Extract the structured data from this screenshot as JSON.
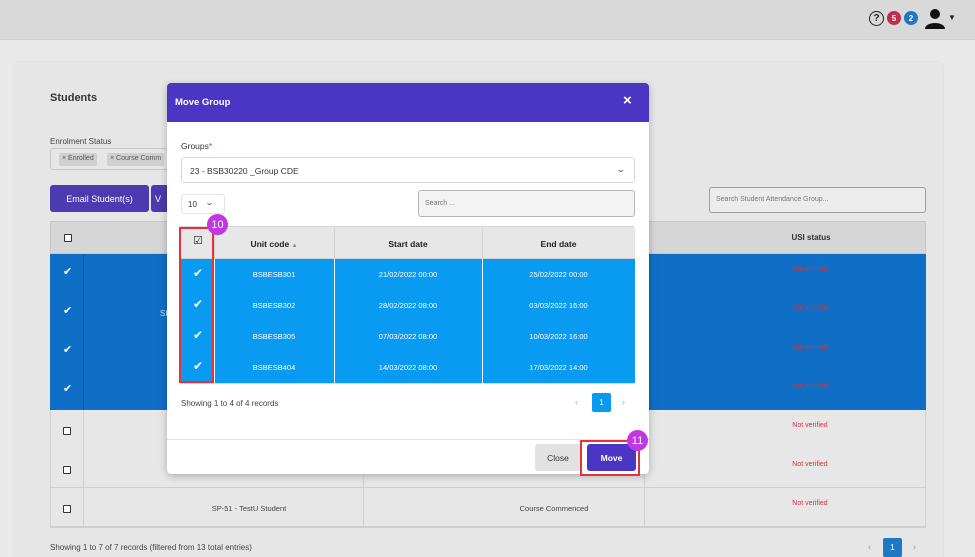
{
  "header": {
    "help_icon": "?",
    "badges": [
      {
        "value": "5",
        "color": "#c22d4b"
      },
      {
        "value": "2",
        "color": "#1d78c6"
      }
    ],
    "user_icon": "user-icon"
  },
  "background": {
    "title": "Students",
    "filter_label": "Enrolment Status",
    "filter_chips": [
      "× Enrolled",
      "× Course Comm"
    ],
    "email_button": "Email Student(s)",
    "partial_button": "V",
    "attendance_search_placeholder": "Search Student Attendance Group...",
    "usi_header": "USI status",
    "usi_values": [
      "Not verified",
      "Not verified",
      "Not verified",
      "Not verified",
      "Not verified",
      "Not verified",
      "Not verified"
    ],
    "partial_text": "SI",
    "last_row": {
      "student": "SP-51 - TestU Student",
      "status": "Course Commenced"
    },
    "showing": "Showing 1 to 7 of 7 records (filtered from 13 total entries)",
    "page": "1"
  },
  "modal": {
    "title": "Move Group",
    "close_symbol": "×",
    "groups_label": "Groups",
    "required_mark": "*",
    "group_selected": "23 - BSB30220 _Group CDE",
    "page_length": "10",
    "search_placeholder": "Search ...",
    "columns": [
      "Unit code",
      "Start date",
      "End date"
    ],
    "rows": [
      {
        "unit": "BSBESB301",
        "start": "21/02/2022 00:00",
        "end": "25/02/2022 00:00",
        "checked": true
      },
      {
        "unit": "BSBESB302",
        "start": "28/02/2022 08:00",
        "end": "03/03/2022 16:00",
        "checked": true
      },
      {
        "unit": "BSBESB305",
        "start": "07/03/2022 08:00",
        "end": "10/03/2022 16:00",
        "checked": true
      },
      {
        "unit": "BSBESB404",
        "start": "14/03/2022 08:00",
        "end": "17/03/2022 14:00",
        "checked": true
      }
    ],
    "showing": "Showing 1 to 4 of 4 records",
    "page": "1",
    "close_button": "Close",
    "move_button": "Move"
  },
  "annotations": {
    "step_checkboxes": "10",
    "step_move": "11"
  },
  "colors": {
    "modal_header": "#4a35c4",
    "row_selected": "#099af2",
    "annotation_box": "#e0333b",
    "annotation_badge": "#c236e3",
    "warning_text": "#d0343a"
  }
}
